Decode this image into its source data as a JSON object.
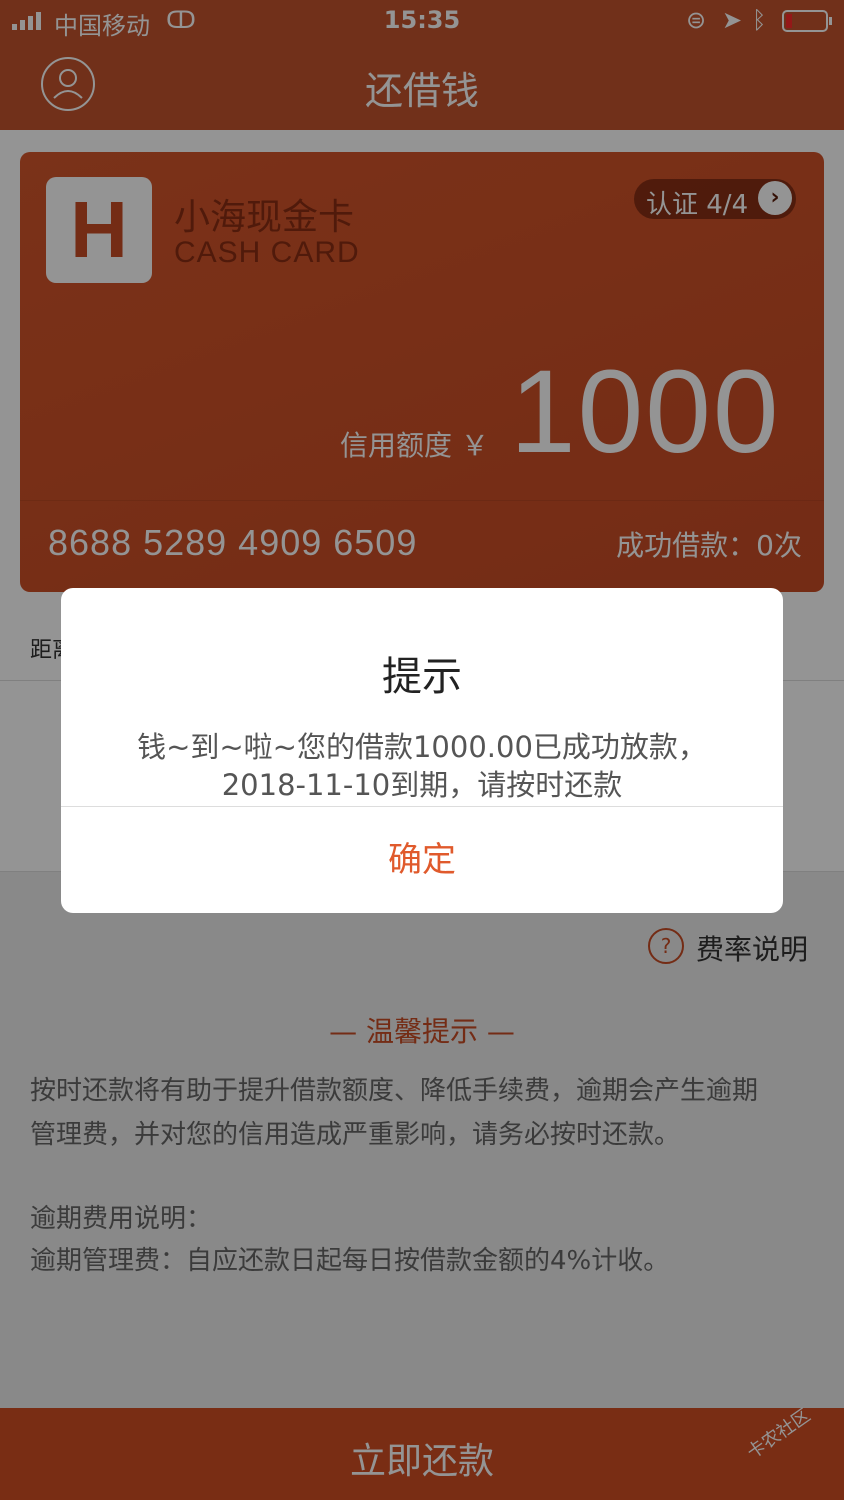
{
  "status_bar": {
    "carrier": "中国移动",
    "time": "15:35"
  },
  "header": {
    "title": "还借钱"
  },
  "card": {
    "logo_letter": "H",
    "name": "小海现金卡",
    "subtitle": "CASH CARD",
    "cert_label": "认证 4/4",
    "credit_label": "信用额度 ￥",
    "amount": "1000",
    "card_number": "8688  5289  4909  6509",
    "success_label": "成功借款：0次"
  },
  "row1": {
    "label": "距离"
  },
  "fee_link": {
    "label": "费率说明"
  },
  "tips": {
    "title": "— 温馨提示 —",
    "line1": "按时还款将有助于提升借款额度、降低手续费，逾期会产生逾期",
    "line2": "管理费，并对您的信用造成严重影响，请务必按时还款。",
    "line3": "逾期费用说明：",
    "line4": "逾期管理费：自应还款日起每日按借款金额的4%计收。"
  },
  "bottom_button": {
    "label": "立即还款"
  },
  "watermark": "卡农社区",
  "dialog": {
    "title": "提示",
    "message_line1": "钱~到~啦~您的借款1000.00已成功放款，",
    "message_line2": "2018-11-10到期，请按时还款",
    "ok_label": "确定"
  }
}
